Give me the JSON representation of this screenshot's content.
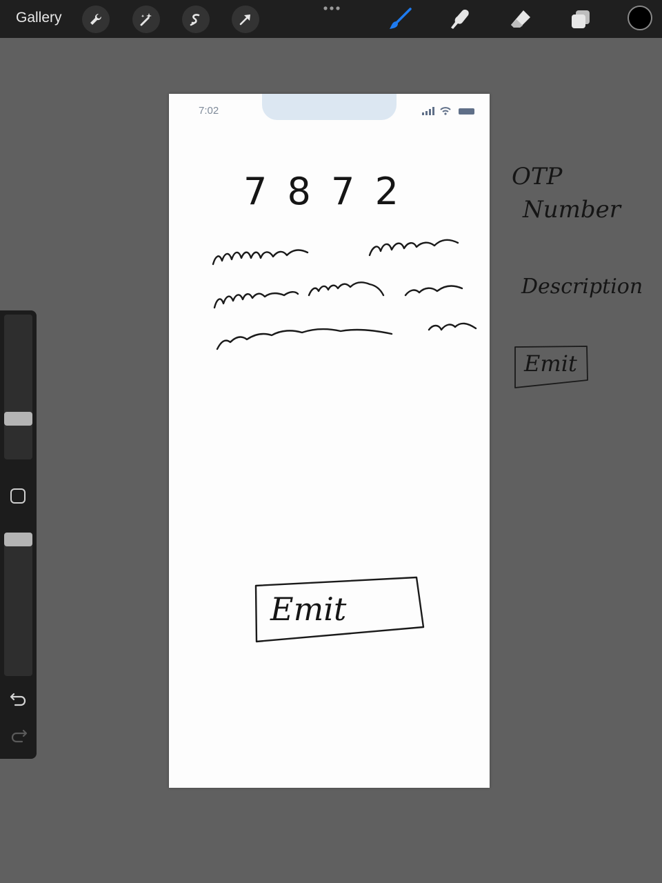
{
  "toolbar": {
    "gallery_label": "Gallery",
    "left_tools": [
      "wrench-icon",
      "magic-wand-icon",
      "selection-icon",
      "transform-arrow-icon"
    ],
    "right_tools": [
      "brush-icon",
      "smudge-icon",
      "eraser-icon",
      "layers-icon"
    ],
    "active_tool": "brush-icon",
    "active_color": "#000000",
    "accent": "#1e7bf0"
  },
  "sidebar": {
    "items": [
      "brush-size-slider",
      "modify-button",
      "opacity-slider",
      "undo-icon",
      "redo-icon"
    ]
  },
  "canvas": {
    "phone_time": "7:02",
    "otp_digits": "7 8 7 2",
    "button_label": "Emit"
  },
  "annotations": {
    "otp_line1": "OTP",
    "otp_line2": "Number",
    "description": "Description",
    "emit": "Emit"
  }
}
